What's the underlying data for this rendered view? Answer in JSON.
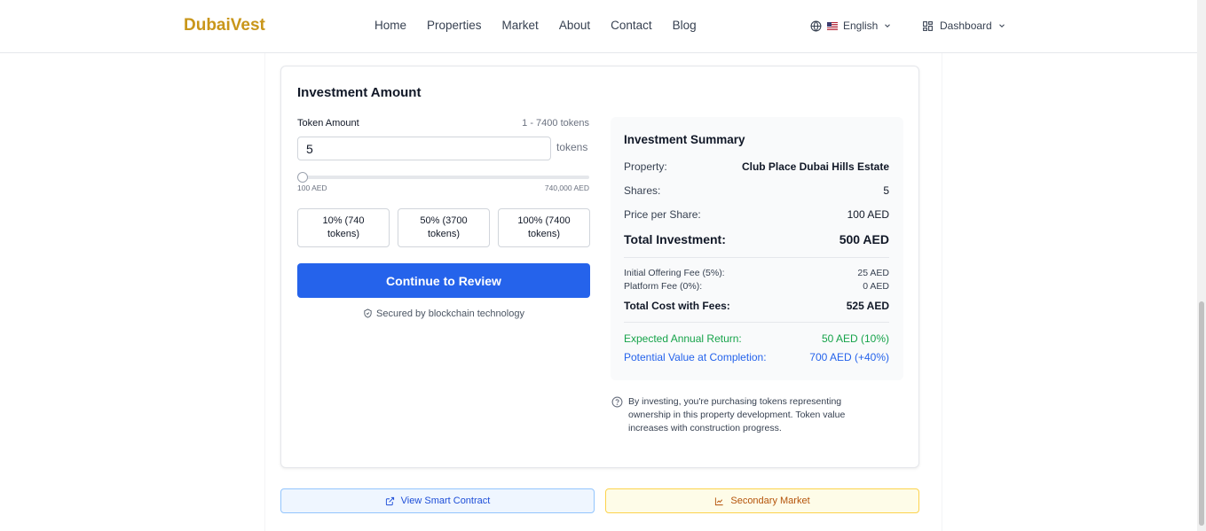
{
  "header": {
    "logo": "DubaiVest",
    "nav": [
      "Home",
      "Properties",
      "Market",
      "About",
      "Contact",
      "Blog"
    ],
    "language": "English",
    "dashboard": "Dashboard"
  },
  "investment": {
    "title": "Investment Amount",
    "token_label": "Token Amount",
    "range_note": "1 - 7400 tokens",
    "token_value": "5",
    "tokens_suffix": "tokens",
    "slider_min": "100 AED",
    "slider_max": "740,000 AED",
    "slider_fraction": 0.0005,
    "quick_buttons": [
      "10% (740 tokens)",
      "50% (3700 tokens)",
      "100% (7400 tokens)"
    ],
    "continue_label": "Continue to Review",
    "secured_text": "Secured by blockchain technology"
  },
  "summary": {
    "title": "Investment Summary",
    "property_label": "Property:",
    "property_value": "Club Place Dubai Hills Estate",
    "shares_label": "Shares:",
    "shares_value": "5",
    "price_label": "Price per Share:",
    "price_value": "100 AED",
    "total_label": "Total Investment:",
    "total_value": "500 AED",
    "offering_fee_label": "Initial Offering Fee (5%):",
    "offering_fee_value": "25 AED",
    "platform_fee_label": "Platform Fee (0%):",
    "platform_fee_value": "0 AED",
    "total_cost_label": "Total Cost with Fees:",
    "total_cost_value": "525 AED",
    "return_label": "Expected Annual Return:",
    "return_value": "50 AED (10%)",
    "potential_label": "Potential Value at Completion:",
    "potential_value": "700 AED (+40%)"
  },
  "disclaimer": "By investing, you're purchasing tokens representing ownership in this property development. Token value increases with construction progress.",
  "bottom": {
    "smart_contract": "View Smart Contract",
    "secondary_market": "Secondary Market"
  },
  "colors": {
    "brand": "#c9961a",
    "primary": "#2563eb",
    "green": "#16a34a"
  }
}
